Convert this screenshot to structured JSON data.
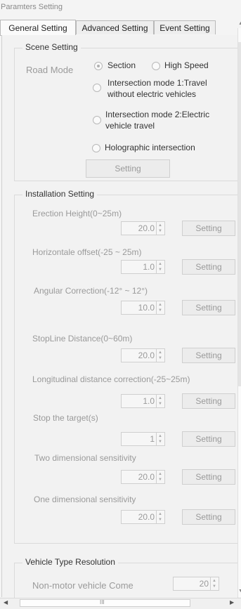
{
  "window": {
    "title": "Paramters Setting"
  },
  "tabs": [
    {
      "label": "General Setting",
      "active": true
    },
    {
      "label": "Advanced Setting",
      "active": false
    },
    {
      "label": "Event Setting",
      "active": false
    }
  ],
  "scene": {
    "title": "Scene Setting",
    "road_mode_label": "Road Mode",
    "options": [
      {
        "label": "Section",
        "checked": true
      },
      {
        "label": "High Speed",
        "checked": false
      },
      {
        "label": "Intersection mode 1:Travel without electric vehicles",
        "line1": "Intersection mode 1:Travel",
        "line2": "without electric vehicles",
        "checked": false
      },
      {
        "label": "Intersection mode 2:Electric vehicle travel",
        "line1": "Intersection mode 2:Electric",
        "line2": "vehicle travel",
        "checked": false
      },
      {
        "label": "Holographic intersection",
        "checked": false
      }
    ],
    "setting_button": "Setting"
  },
  "installation": {
    "title": "Installation Setting",
    "setting_button": "Setting",
    "items": [
      {
        "label": "Erection Height(0~25m)",
        "value": "20.0"
      },
      {
        "label": "Horizontale offset(-25 ~ 25m)",
        "value": "1.0"
      },
      {
        "label": "Angular Correction(-12° ~ 12°)",
        "value": "10.0"
      },
      {
        "label": "StopLine Distance(0~60m)",
        "value": "20.0"
      },
      {
        "label": "Longitudinal distance correction(-25~25m)",
        "value": "1.0"
      },
      {
        "label": "Stop the target(s)",
        "value": "1"
      },
      {
        "label": "Two dimensional sensitivity",
        "value": "20.0"
      },
      {
        "label": "One dimensional sensitivity",
        "value": "20.0"
      }
    ]
  },
  "vehicle": {
    "title": "Vehicle Type Resolution",
    "items": [
      {
        "label": "Non-motor vehicle Come",
        "value": "20"
      }
    ]
  },
  "scrollbar": {
    "h_thumb_glyph": "III"
  }
}
